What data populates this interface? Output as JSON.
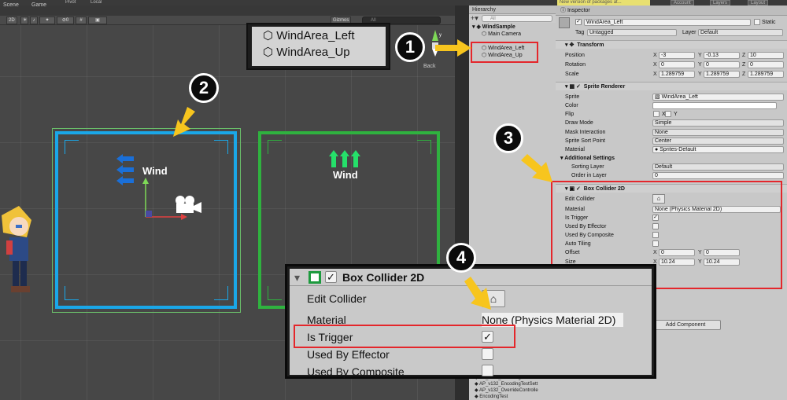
{
  "topbar": {
    "pivot": "Pivot",
    "local": "Local",
    "new_version": "New version of packages at...",
    "account": "Account",
    "layers": "Layers",
    "layout": "Layout"
  },
  "scene": {
    "tabs": [
      "Scene",
      "Game"
    ],
    "mode_2d": "2D",
    "gizmos": "Gizmos",
    "search_placeholder": "All",
    "back_label": "Back",
    "wind_left_label": "Wind",
    "wind_up_label": "Wind",
    "colors": {
      "left_frame": "#1aa7e8",
      "up_frame": "#2fb23f",
      "left_arrows": "#1a6fd8",
      "up_arrows": "#25e06a"
    }
  },
  "tooltip": {
    "items": [
      "WindArea_Left",
      "WindArea_Up"
    ]
  },
  "badges": [
    "1",
    "2",
    "3",
    "4"
  ],
  "hierarchy": {
    "title": "Hierarchy",
    "search_placeholder": "All",
    "items": [
      {
        "label": "WindSample"
      },
      {
        "label": "Main Camera"
      },
      {
        "label": "WindArea_Left"
      },
      {
        "label": "WindArea_Up"
      }
    ],
    "bottom_items": [
      "AP_v132_EncodingTest",
      "AP_v132_EncodingTestSett",
      "AP_v132_OverrideControlle",
      "EncodingTest"
    ]
  },
  "inspector": {
    "title": "Inspector",
    "object_name": "WindArea_Left",
    "static_label": "Static",
    "tag_label": "Tag",
    "tag_value": "Untagged",
    "layer_label": "Layer",
    "layer_value": "Default",
    "transform": {
      "title": "Transform",
      "position_label": "Position",
      "position": [
        "-3",
        "-0.13",
        "10"
      ],
      "rotation_label": "Rotation",
      "rotation": [
        "0",
        "0",
        "0"
      ],
      "scale_label": "Scale",
      "scale": [
        "1.289759",
        "1.289759",
        "1.289759"
      ]
    },
    "sprite_renderer": {
      "title": "Sprite Renderer",
      "sprite_label": "Sprite",
      "sprite_value": "WindArea_Left",
      "color_label": "Color",
      "flip_label": "Flip",
      "flip_x": "X",
      "flip_y": "Y",
      "draw_mode_label": "Draw Mode",
      "draw_mode_value": "Simple",
      "mask_label": "Mask Interaction",
      "mask_value": "None",
      "sort_point_label": "Sprite Sort Point",
      "sort_point_value": "Center",
      "material_label": "Material",
      "material_value": "Sprites-Default",
      "additional_settings": "Additional Settings",
      "sorting_layer_label": "Sorting Layer",
      "sorting_layer_value": "Default",
      "order_label": "Order in Layer",
      "order_value": "0"
    },
    "box_collider": {
      "title": "Box Collider 2D",
      "edit_label": "Edit Collider",
      "material_label": "Material",
      "material_value": "None (Physics Material 2D)",
      "is_trigger_label": "Is Trigger",
      "is_trigger": "✓",
      "used_by_effector_label": "Used By Effector",
      "used_by_composite_label": "Used By Composite",
      "auto_tiling_label": "Auto Tiling",
      "offset_label": "Offset",
      "offset": [
        "0",
        "0"
      ],
      "size_label": "Size",
      "size": [
        "10.24",
        "10.24"
      ]
    },
    "add_component": "Add Component"
  },
  "zoom": {
    "title": "Box Collider 2D",
    "edit_label": "Edit Collider",
    "material_label": "Material",
    "material_value": "None (Physics Material 2D)",
    "is_trigger_label": "Is Trigger",
    "is_trigger": "✓",
    "used_by_effector_label": "Used By Effector",
    "used_by_composite_label": "Used By Composite"
  }
}
